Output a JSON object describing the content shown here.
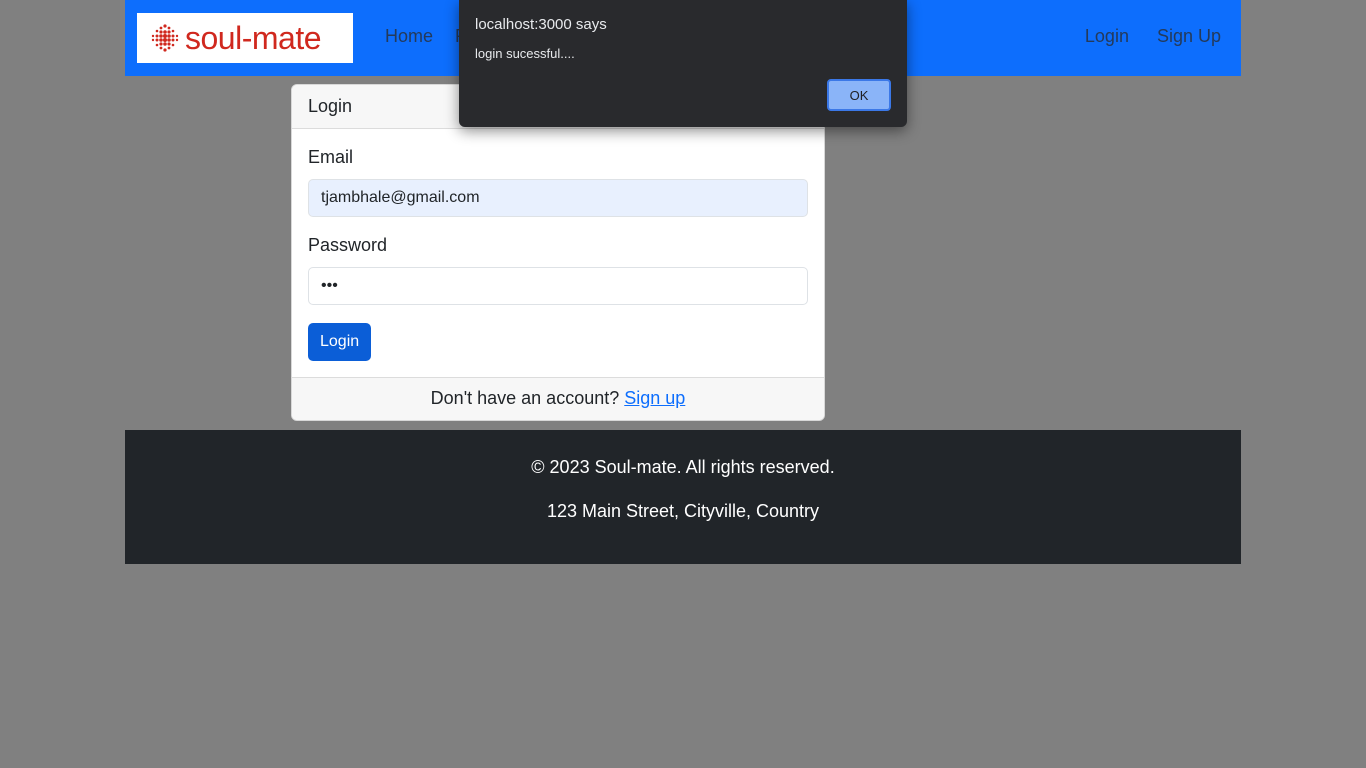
{
  "navbar": {
    "brand_text": "soul-mate",
    "brand_color": "#d0281e",
    "left_links": [
      "Home",
      "P"
    ],
    "right_links": [
      "Login",
      "Sign Up"
    ],
    "background": "#0d6efd"
  },
  "card": {
    "header": "Login",
    "email_label": "Email",
    "email_value": "tjambhale@gmail.com",
    "password_label": "Password",
    "password_value": "•••",
    "submit_label": "Login",
    "footer_text": "Don't have an account?",
    "footer_link": "Sign up"
  },
  "footer": {
    "copyright": "© 2023 Soul-mate. All rights reserved.",
    "address": "123 Main Street, Cityville, Country"
  },
  "dialog": {
    "title": "localhost:3000 says",
    "message": "login sucessful....",
    "ok_label": "OK"
  }
}
